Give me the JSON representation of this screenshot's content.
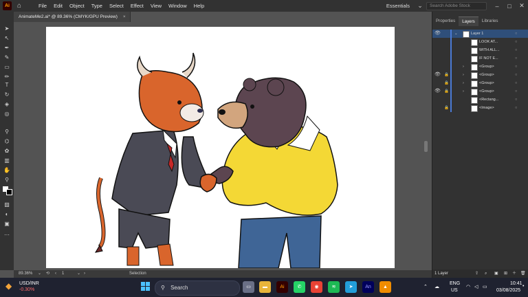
{
  "app": {
    "logo": "Ai"
  },
  "menu": [
    "File",
    "Edit",
    "Object",
    "Type",
    "Select",
    "Effect",
    "View",
    "Window",
    "Help"
  ],
  "workspace": {
    "label": "Essentials",
    "search_placeholder": "Search Adobe Stock"
  },
  "document": {
    "tab_title": "AnimateMe2.ai* @ 89.36% (CMYK/GPU Preview)",
    "close": "×"
  },
  "status_bar": {
    "zoom": "89.36%",
    "artboard": "1",
    "tool": "Selection"
  },
  "panel": {
    "tabs": [
      "Properties",
      "Layers",
      "Libraries"
    ],
    "layers": [
      {
        "name": "Layer 1",
        "visible": true,
        "locked": false
      },
      {
        "name": "LOOK AT...",
        "visible": false,
        "locked": false
      },
      {
        "name": "WITH ALL...",
        "visible": false,
        "locked": false
      },
      {
        "name": "IF NOT E...",
        "visible": false,
        "locked": false
      },
      {
        "name": "<Group>",
        "visible": false,
        "locked": false
      },
      {
        "name": "<Group>",
        "visible": true,
        "locked": true
      },
      {
        "name": "<Group>",
        "visible": false,
        "locked": true
      },
      {
        "name": "<Group>",
        "visible": true,
        "locked": true
      },
      {
        "name": "<Rectang...",
        "visible": false,
        "locked": false
      },
      {
        "name": "<Image>",
        "visible": false,
        "locked": true
      }
    ],
    "footer": "1 Layer"
  },
  "taskbar": {
    "ticker": "USD/INR",
    "change": "-0.30%",
    "search": "Search",
    "lang1": "ENG",
    "lang2": "US",
    "time": "10:41",
    "date": "03/08/2025"
  },
  "icons": [
    "home-icon",
    "eye-icon",
    "lock-icon",
    "windows-start-icon",
    "search-icon",
    "wifi-icon",
    "volume-icon",
    "battery-icon"
  ]
}
